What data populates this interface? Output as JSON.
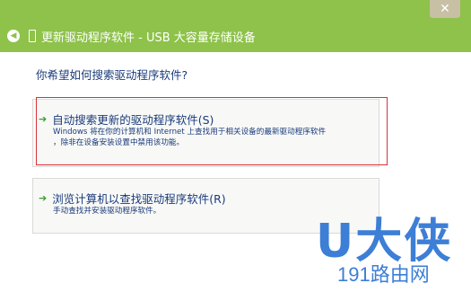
{
  "window": {
    "title": "更新驱动程序软件 - USB 大容量存储设备",
    "close_glyph": "✕",
    "back_glyph": "◀"
  },
  "question": "你希望如何搜索驱动程序软件?",
  "options": [
    {
      "title": "自动搜索更新的驱动程序软件(S)",
      "desc_line1": "Windows 将在你的计算机和 Internet 上查找用于相关设备的最新驱动程序软件",
      "desc_line2": "，除非在设备安装设置中禁用该功能。",
      "arrow": "➔"
    },
    {
      "title": "浏览计算机以查找驱动程序软件(R)",
      "desc_line1": "手动查找并安装驱动程序软件。",
      "arrow": "➔"
    }
  ],
  "watermark": {
    "big": "U大侠",
    "small": "191路由网"
  },
  "colors": {
    "titlebar": "#8ec24a",
    "text": "#1a3a7a",
    "arrow": "#3a9d2f",
    "highlight": "#d8323b",
    "watermark": "#3d7ed6"
  }
}
